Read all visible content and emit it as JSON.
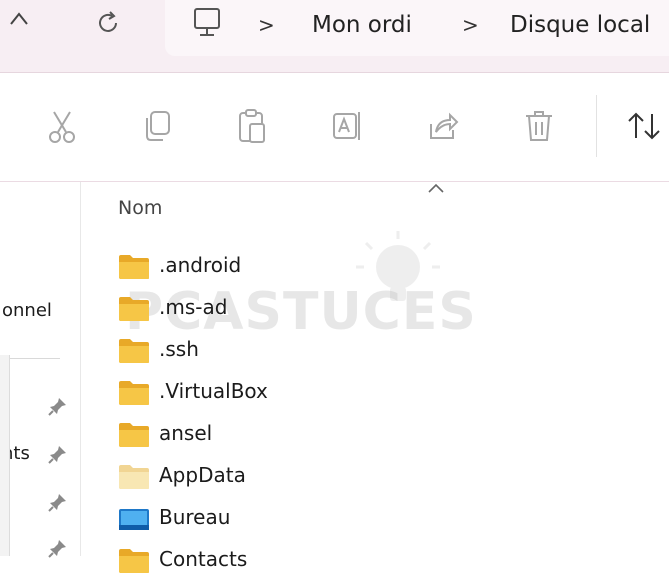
{
  "window": {
    "breadcrumb": [
      "Mon ordi",
      "Disque local"
    ],
    "separator": ">"
  },
  "toolbar": {
    "buttons": [
      "cut-icon",
      "copy-icon",
      "paste-icon",
      "rename-icon",
      "share-icon",
      "delete-icon",
      "sort-icon"
    ]
  },
  "navigation": {
    "items": [
      {
        "label": "onnel",
        "pinned": false
      },
      {
        "label": "",
        "pinned": true
      },
      {
        "label": "nts",
        "pinned": true
      },
      {
        "label": "",
        "pinned": true
      },
      {
        "label": "",
        "pinned": true
      }
    ]
  },
  "content": {
    "column_header": "Nom",
    "sort": "ascending",
    "files": [
      {
        "name": ".android",
        "icon": "folder-icon"
      },
      {
        "name": ".ms-ad",
        "icon": "folder-icon"
      },
      {
        "name": ".ssh",
        "icon": "folder-icon"
      },
      {
        "name": ".VirtualBox",
        "icon": "folder-icon"
      },
      {
        "name": "ansel",
        "icon": "folder-icon"
      },
      {
        "name": "AppData",
        "icon": "folder-hidden-icon"
      },
      {
        "name": "Bureau",
        "icon": "desktop-folder-icon"
      },
      {
        "name": "Contacts",
        "icon": "folder-icon"
      }
    ]
  },
  "watermark": {
    "text": "ASTUCES",
    "prefix": "PC"
  },
  "colors": {
    "topbar_bg": "#f7eef3",
    "folder_yellow": "#f4c542",
    "folder_hidden": "#f8e7b3",
    "desktop_blue": "#2b88d8"
  }
}
